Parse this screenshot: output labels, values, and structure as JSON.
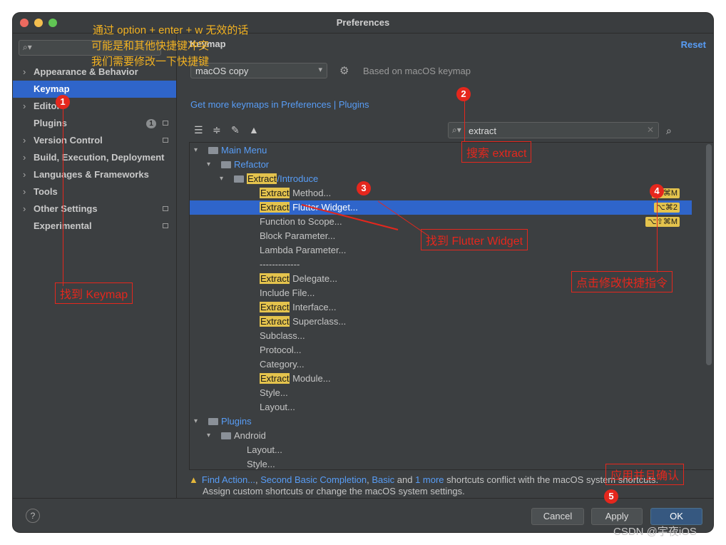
{
  "window": {
    "title": "Preferences"
  },
  "sidebar": {
    "items": [
      {
        "label": "Appearance & Behavior",
        "arrow": "›"
      },
      {
        "label": "Keymap",
        "arrow": ""
      },
      {
        "label": "Editor",
        "arrow": "›"
      },
      {
        "label": "Plugins",
        "arrow": "",
        "badge": "1"
      },
      {
        "label": "Version Control",
        "arrow": "›"
      },
      {
        "label": "Build, Execution, Deployment",
        "arrow": "›"
      },
      {
        "label": "Languages & Frameworks",
        "arrow": "›"
      },
      {
        "label": "Tools",
        "arrow": "›"
      },
      {
        "label": "Other Settings",
        "arrow": "›"
      },
      {
        "label": "Experimental",
        "arrow": ""
      }
    ]
  },
  "main": {
    "title": "Keymap",
    "reset": "Reset",
    "keymap_value": "macOS copy",
    "based_on": "Based on macOS keymap",
    "more_link": "Get more keymaps in Preferences | Plugins",
    "search_value": "extract"
  },
  "tree": {
    "main_menu": "Main Menu",
    "refactor": "Refactor",
    "extract": "Extract",
    "introduce": "/Introduce",
    "items": [
      {
        "hl": "Extract",
        "rest": " Method...",
        "shortcut": "⌥⌘M"
      },
      {
        "hl": "Extract",
        "rest": " Flutter Widget...",
        "shortcut": "⌥⌘2"
      },
      {
        "hl": "",
        "rest": "Function to Scope...",
        "shortcut": "⌥⇧⌘M"
      },
      {
        "hl": "",
        "rest": "Block Parameter...",
        "shortcut": ""
      },
      {
        "hl": "",
        "rest": "Lambda Parameter...",
        "shortcut": ""
      },
      {
        "hl": "",
        "rest": "-------------",
        "shortcut": ""
      },
      {
        "hl": "Extract",
        "rest": " Delegate...",
        "shortcut": ""
      },
      {
        "hl": "",
        "rest": "Include File...",
        "shortcut": ""
      },
      {
        "hl": "Extract",
        "rest": " Interface...",
        "shortcut": ""
      },
      {
        "hl": "Extract",
        "rest": " Superclass...",
        "shortcut": ""
      },
      {
        "hl": "",
        "rest": "Subclass...",
        "shortcut": ""
      },
      {
        "hl": "",
        "rest": "Protocol...",
        "shortcut": ""
      },
      {
        "hl": "",
        "rest": "Category...",
        "shortcut": ""
      },
      {
        "hl": "Extract",
        "rest": " Module...",
        "shortcut": ""
      },
      {
        "hl": "",
        "rest": "Style...",
        "shortcut": ""
      },
      {
        "hl": "",
        "rest": "Layout...",
        "shortcut": ""
      }
    ],
    "plugins": "Plugins",
    "android": "Android",
    "android_items": [
      "Layout...",
      "Style..."
    ]
  },
  "warning": {
    "links": [
      "Find Action...",
      "Second Basic Completion",
      "Basic",
      "1 more"
    ],
    "sep1": ", ",
    "and": " and ",
    "tail": " shortcuts conflict with the macOS system shortcuts.",
    "line2": "Assign custom shortcuts or change the macOS system settings."
  },
  "footer": {
    "help": "?",
    "cancel": "Cancel",
    "apply": "Apply",
    "ok": "OK"
  },
  "annotations": {
    "note_lines": [
      "通过 option + enter + w 无效的话",
      "可能是和其他快捷键冲突",
      "我们需要修改一下快捷键"
    ],
    "find_keymap": "找到 Keymap",
    "search_extract": "搜索 extract",
    "find_flutter": "找到 Flutter Widget",
    "click_modify": "点击修改快捷指令",
    "apply_confirm": "应用并且确认",
    "nums": [
      "1",
      "2",
      "3",
      "4",
      "5"
    ]
  },
  "watermark": "CSDN @宇夜iOS"
}
